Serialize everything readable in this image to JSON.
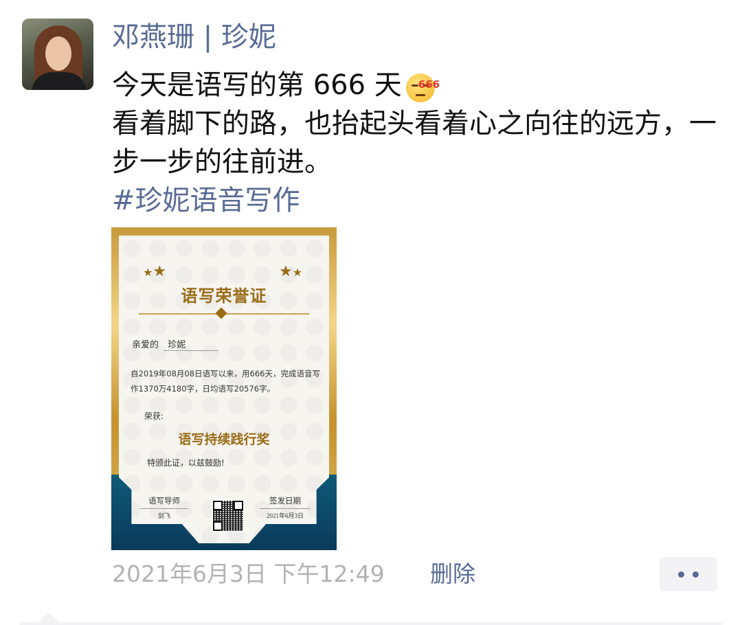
{
  "user": {
    "name": "邓燕珊 | 珍妮"
  },
  "post": {
    "line1": "今天是语写的第 666 天",
    "emoji_badge": "666",
    "line2": "看着脚下的路，也抬起头看着心之向往的远方，一步一步的往前进。",
    "hashtag": "#珍妮语音写作"
  },
  "certificate": {
    "title": "语写荣誉证",
    "dear_label": "亲爱的",
    "recipient": "珍妮",
    "body": "自2019年08月08日语写以来，用666天，完成语音写作1370万4180字，日均语写20576字。",
    "honor_label": "荣获:",
    "award": "语写持续践行奖",
    "encourage": "特颁此证，以兹鼓励!",
    "mentor_label": "语写导师",
    "mentor_name": "剑飞",
    "date_label": "签发日期",
    "date_value": "2021年6月3日"
  },
  "footer": {
    "timestamp": "2021年6月3日 下午12:49",
    "delete_label": "删除",
    "more_icon": "more-dots-icon"
  },
  "colors": {
    "link": "#576b95",
    "gold": "#9a6c17",
    "navy": "#0b3a5a"
  }
}
